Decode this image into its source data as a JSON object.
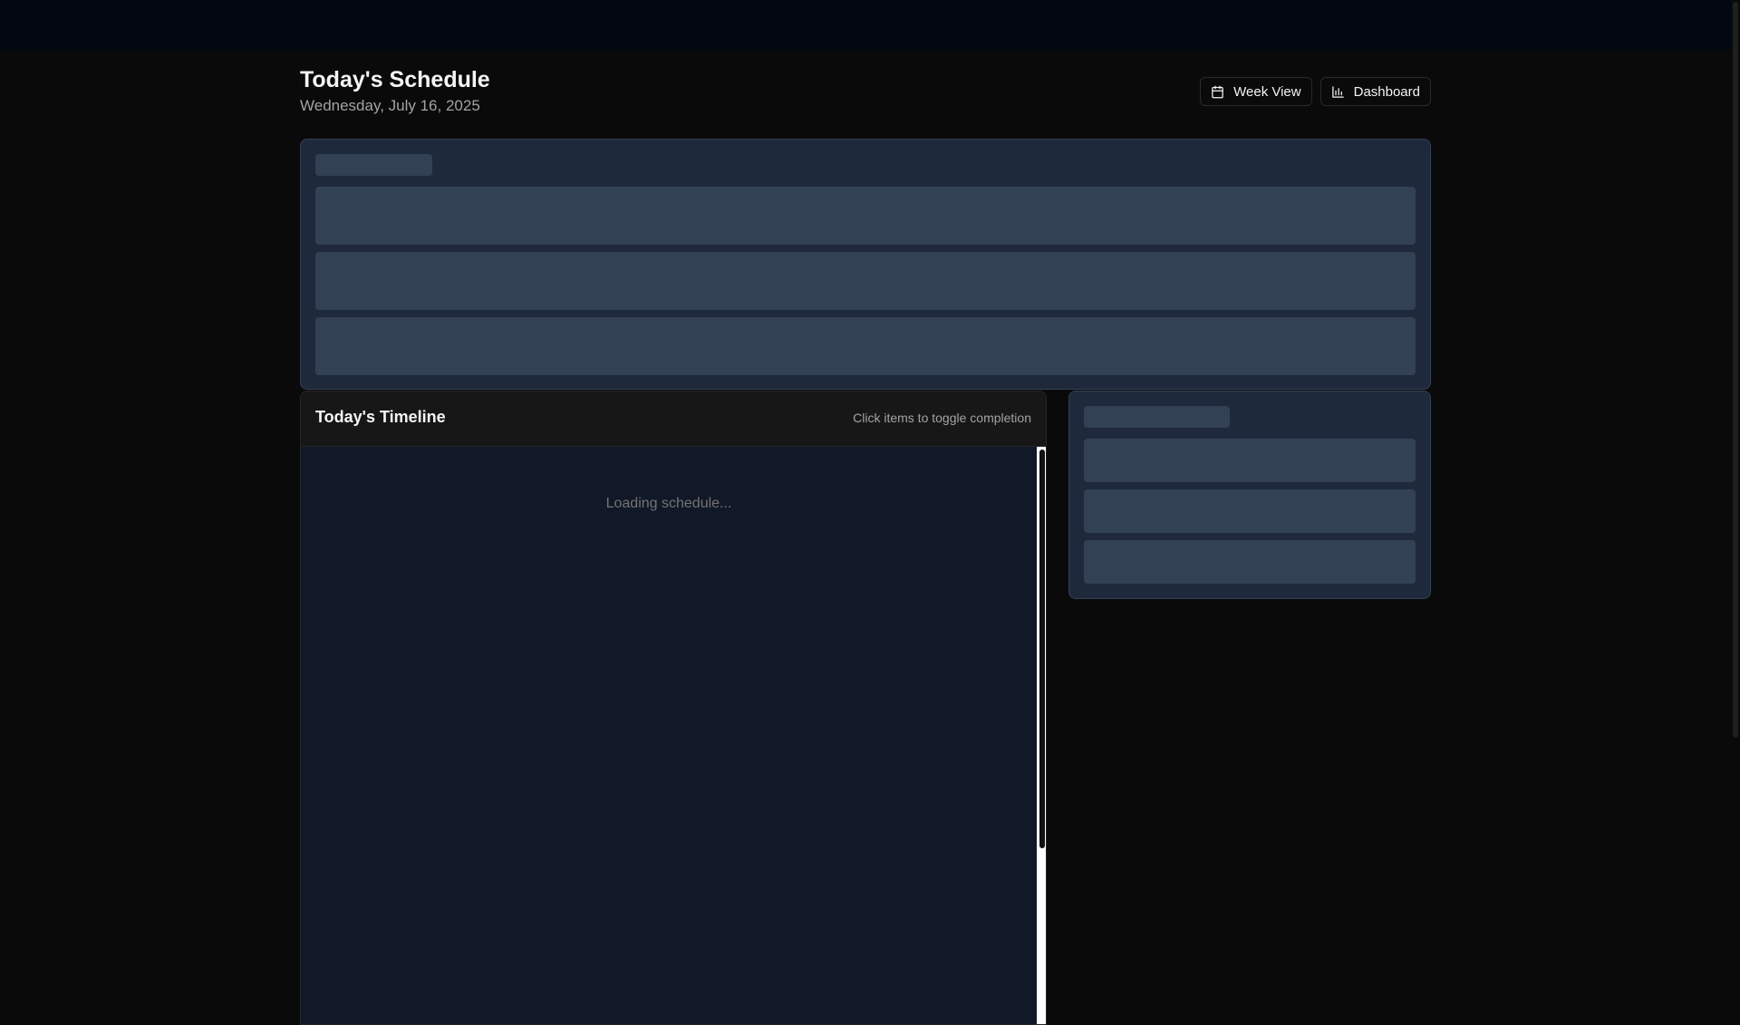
{
  "header": {
    "title": "Today's Schedule",
    "date": "Wednesday, July 16, 2025",
    "actions": {
      "week_view_label": "Week View",
      "week_view_icon": "calendar-icon",
      "dashboard_label": "Dashboard",
      "dashboard_icon": "bar-chart-icon"
    }
  },
  "timeline": {
    "title": "Today's Timeline",
    "hint": "Click items to toggle completion",
    "loading_text": "Loading schedule..."
  },
  "colors": {
    "background": "#0a0a0a",
    "topbar": "#030712",
    "card": "#1e293b",
    "skeleton": "#334155",
    "timeline_body": "#111827",
    "text_primary": "#f5f5f5",
    "text_muted": "#a3a3a3"
  }
}
